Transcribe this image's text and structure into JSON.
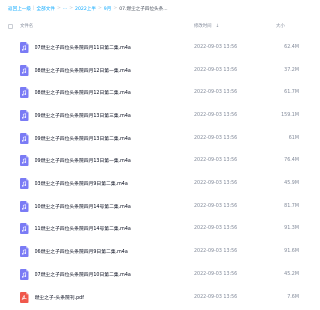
{
  "breadcrumb": {
    "items": [
      {
        "label": "返回上一级",
        "type": "link"
      },
      {
        "label": "全部文件",
        "type": "link"
      },
      {
        "label": "...",
        "type": "link"
      },
      {
        "label": "2022上半",
        "type": "link"
      },
      {
        "label": "9月",
        "type": "link"
      },
      {
        "label": "07.燃尘之子四位头条...",
        "type": "current"
      }
    ],
    "separators": [
      "|",
      ">",
      ">",
      ">",
      ">"
    ]
  },
  "table": {
    "headers": {
      "name": "文件名",
      "time": "修改时间",
      "size": "大小"
    },
    "sort_indicator": "↓",
    "rows": [
      {
        "name": "07燃尘之子四位头条院四月11日第二集.m4a",
        "time": "2022-09-03 13:56",
        "size": "62.4M",
        "icon": "audio-file-icon"
      },
      {
        "name": "08燃尘之子四位头条院四月12日第一集.m4a",
        "time": "2022-09-03 13:56",
        "size": "37.2M",
        "icon": "audio-file-icon"
      },
      {
        "name": "08燃尘之子四位头条院四月12日第二集.m4a",
        "time": "2022-09-03 13:56",
        "size": "61.7M",
        "icon": "audio-file-icon"
      },
      {
        "name": "09燃尘之子四位头条院四月13日第三集.m4a",
        "time": "2022-09-03 13:56",
        "size": "159.1M",
        "icon": "audio-file-icon"
      },
      {
        "name": "09燃尘之子四位头条院四月13日第二集.m4a",
        "time": "2022-09-03 13:56",
        "size": "61M",
        "icon": "audio-file-icon"
      },
      {
        "name": "09燃尘之子四位头条院四月13日第一集.m4a",
        "time": "2022-09-03 13:56",
        "size": "76.4M",
        "icon": "audio-file-icon"
      },
      {
        "name": "03燃尘之子四位头条院四月9日第二集.m4a",
        "time": "2022-09-03 13:56",
        "size": "45.9M",
        "icon": "audio-file-icon"
      },
      {
        "name": "10燃尘之子四位头条院四月14号第二集.m4a",
        "time": "2022-09-03 13:56",
        "size": "81.7M",
        "icon": "audio-file-icon"
      },
      {
        "name": "11燃尘之子四位头条院四月14号第二集.m4a",
        "time": "2022-09-03 13:56",
        "size": "91.3M",
        "icon": "audio-file-icon"
      },
      {
        "name": "06燃尘之子四位头条院四月9日第二集.m4a",
        "time": "2022-09-03 13:56",
        "size": "91.6M",
        "icon": "audio-file-icon"
      },
      {
        "name": "07燃尘之子四位头条院四月10日第二集.m4a",
        "time": "2022-09-03 13:56",
        "size": "45.2M",
        "icon": "audio-file-icon"
      },
      {
        "name": "燃尘之子-头条院刊.pdf",
        "time": "2022-09-03 13:56",
        "size": "7.6M",
        "icon": "pdf-file-icon"
      }
    ]
  },
  "colors": {
    "link": "#06a7ff",
    "audio_icon": "#7a7bf5",
    "pdf_icon": "#f0584c",
    "muted_text": "#818999",
    "primary_text": "#03081a"
  }
}
